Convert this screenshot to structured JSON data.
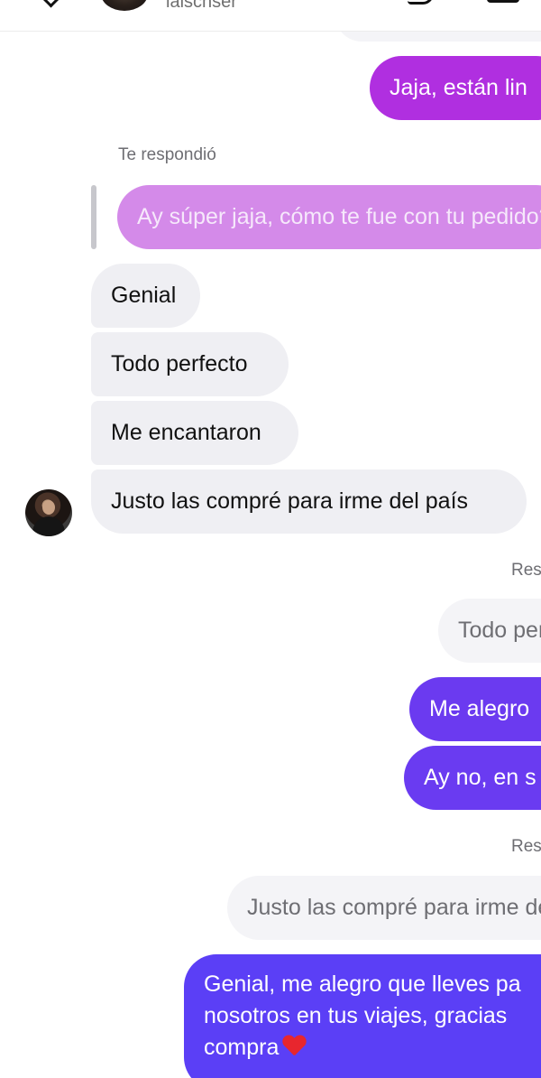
{
  "header": {
    "username": "laischser",
    "back_icon": "chevron-left-icon",
    "call_icon": "phone-icon",
    "video_icon": "video-camera-icon"
  },
  "colors": {
    "incoming_bubble": "#efeff3",
    "outgoing_top": "#b02fe0",
    "outgoing_mid": "#6b3af0",
    "outgoing_bottom": "#5b3ff6",
    "quoted_bubble": "#d48ae9"
  },
  "messages": {
    "m0_text": "Jaja, están lin",
    "reply1_label": "Te respondió",
    "reply1_quote": "Ay súper jaja, cómo te fue con tu pedido?",
    "m1_text": "Genial",
    "m2_text": "Todo perfecto",
    "m3_text": "Me encantaron",
    "m4_text": "Justo las compré para irme del país",
    "reply2_label": "Res",
    "reply2_quote": "Todo per",
    "m5_text": "Me alegro",
    "m6_text": "Ay no, en s",
    "reply3_label": "Res",
    "reply3_quote": "Justo las compré para irme de",
    "m7_line1": "Genial, me alegro que lleves pa",
    "m7_line2": "nosotros en tus viajes, gracias",
    "m7_line3": "compra"
  }
}
